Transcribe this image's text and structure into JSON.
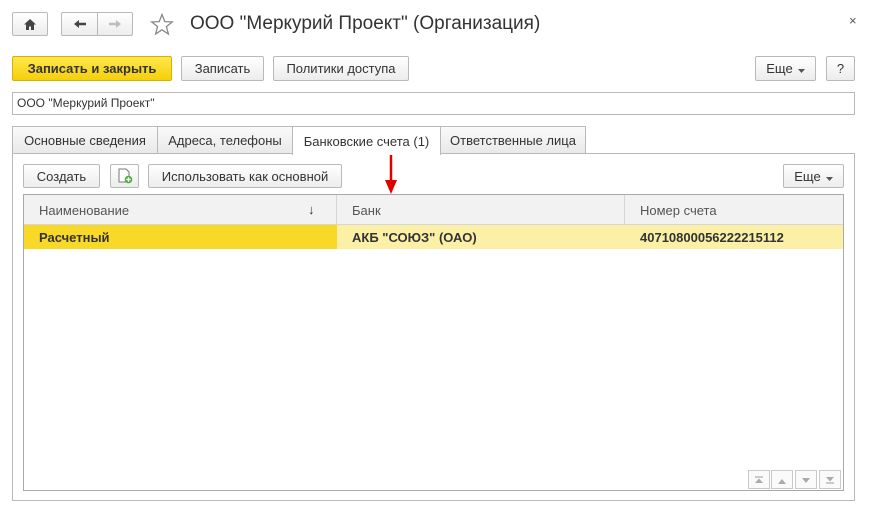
{
  "window": {
    "title": "ООО \"Меркурий Проект\" (Организация)",
    "close_glyph": "×"
  },
  "icons": {
    "home": "home-icon",
    "back": "arrow-left-icon",
    "forward": "arrow-right-icon",
    "favorite": "star-icon",
    "add_copy": "add-document-icon",
    "dropdown": "chevron-down-icon",
    "sort": "sort-down-icon"
  },
  "toolbar": {
    "save_close_label": "Записать и закрыть",
    "save_label": "Записать",
    "access_label": "Политики доступа",
    "more_label": "Еще",
    "help_label": "?"
  },
  "name_field": {
    "value": "ООО \"Меркурий Проект\""
  },
  "tabs": [
    {
      "label": "Основные сведения",
      "active": false
    },
    {
      "label": "Адреса, телефоны",
      "active": false
    },
    {
      "label": "Банковские счета (1)",
      "active": true
    },
    {
      "label": "Ответственные лица",
      "active": false
    }
  ],
  "accounts_toolbar": {
    "create_label": "Создать",
    "use_main_label": "Использовать как основной",
    "more_label": "Еще"
  },
  "table": {
    "columns": [
      "Наименование",
      "Банк",
      "Номер счета"
    ],
    "sort_glyph": "↓",
    "rows": [
      [
        "Расчетный",
        "АКБ \"СОЮЗ\" (ОАО)",
        "40710800056222215112"
      ]
    ]
  },
  "colors": {
    "accent_yellow": "#f9d928",
    "row_highlight": "#fbf0a6",
    "annotation_arrow": "#e00000"
  }
}
